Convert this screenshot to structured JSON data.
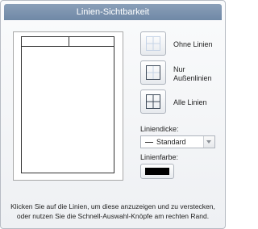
{
  "dialog": {
    "title": "Linien-Sichtbarkeit",
    "help_line1": "Klicken Sie auf die Linien, um diese anzuzeigen und zu verstecken,",
    "help_line2": "oder nutzen Sie die Schnell-Auswahl-Knöpfe am rechten Rand."
  },
  "quick_buttons": {
    "no_lines": "Ohne Linien",
    "outer_lines_1": "Nur",
    "outer_lines_2": "Außenlinien",
    "all_lines": "Alle Linien"
  },
  "line_width": {
    "label": "Liniendicke:",
    "value": "Standard"
  },
  "line_color": {
    "label": "Linienfarbe:",
    "value": "#000000"
  },
  "colors": {
    "accent_title": "#7a91ad",
    "icon_blue": "#5b86c2"
  }
}
